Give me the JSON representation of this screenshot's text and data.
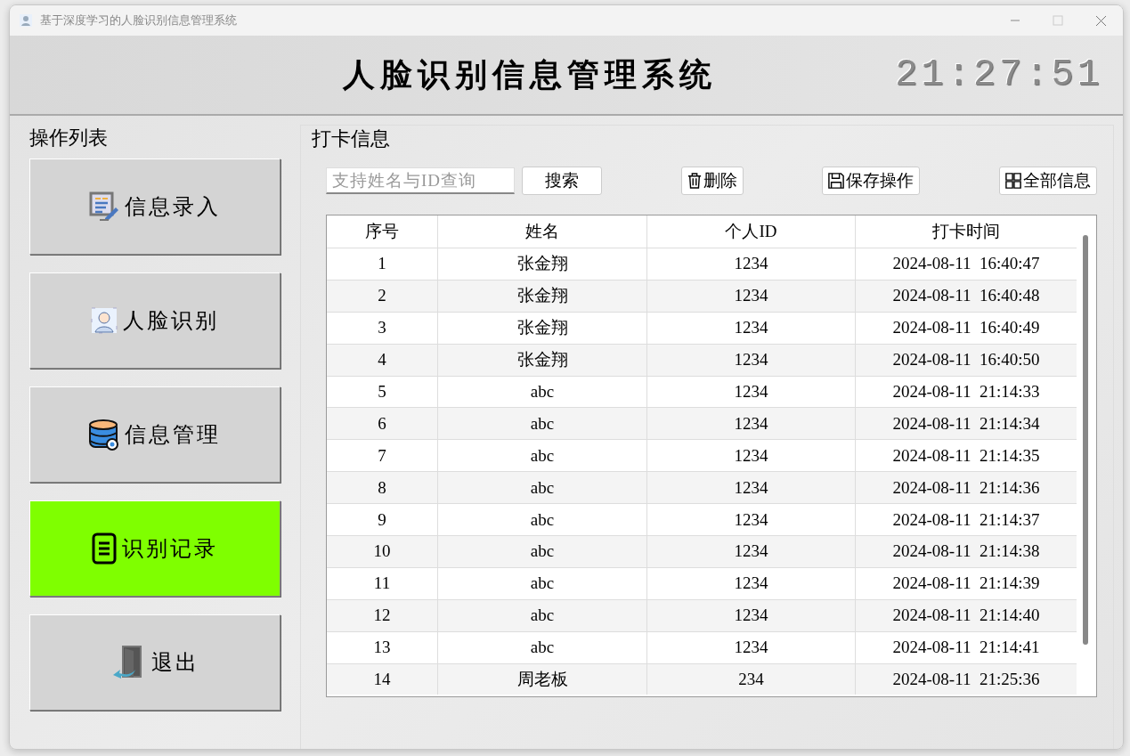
{
  "window": {
    "title": "基于深度学习的人脸识别信息管理系统"
  },
  "header": {
    "title": "人脸识别信息管理系统",
    "clock": "21:27:51"
  },
  "sidebar": {
    "title": "操作列表",
    "items": [
      {
        "label": "信息录入",
        "kind": "entry",
        "selected": false
      },
      {
        "label": "人脸识别",
        "kind": "face",
        "selected": false
      },
      {
        "label": "信息管理",
        "kind": "database",
        "selected": false
      },
      {
        "label": "识别记录",
        "kind": "record",
        "selected": true
      },
      {
        "label": "退出",
        "kind": "exit",
        "selected": false
      }
    ]
  },
  "panel": {
    "title": "打卡信息",
    "search": {
      "placeholder": "支持姓名与ID查询"
    },
    "buttons": [
      {
        "label": "搜索",
        "kind": "plain"
      },
      {
        "label": "删除",
        "kind": "trash"
      },
      {
        "label": "保存操作",
        "kind": "save"
      },
      {
        "label": "全部信息",
        "kind": "grid"
      }
    ]
  },
  "table": {
    "columns": [
      "序号",
      "姓名",
      "个人ID",
      "打卡时间"
    ],
    "rows": [
      [
        "1",
        "张金翔",
        "1234",
        "2024-08-11  16:40:47"
      ],
      [
        "2",
        "张金翔",
        "1234",
        "2024-08-11  16:40:48"
      ],
      [
        "3",
        "张金翔",
        "1234",
        "2024-08-11  16:40:49"
      ],
      [
        "4",
        "张金翔",
        "1234",
        "2024-08-11  16:40:50"
      ],
      [
        "5",
        "abc",
        "1234",
        "2024-08-11  21:14:33"
      ],
      [
        "6",
        "abc",
        "1234",
        "2024-08-11  21:14:34"
      ],
      [
        "7",
        "abc",
        "1234",
        "2024-08-11  21:14:35"
      ],
      [
        "8",
        "abc",
        "1234",
        "2024-08-11  21:14:36"
      ],
      [
        "9",
        "abc",
        "1234",
        "2024-08-11  21:14:37"
      ],
      [
        "10",
        "abc",
        "1234",
        "2024-08-11  21:14:38"
      ],
      [
        "11",
        "abc",
        "1234",
        "2024-08-11  21:14:39"
      ],
      [
        "12",
        "abc",
        "1234",
        "2024-08-11  21:14:40"
      ],
      [
        "13",
        "abc",
        "1234",
        "2024-08-11  21:14:41"
      ],
      [
        "14",
        "周老板",
        "234",
        "2024-08-11  21:25:36"
      ]
    ]
  }
}
